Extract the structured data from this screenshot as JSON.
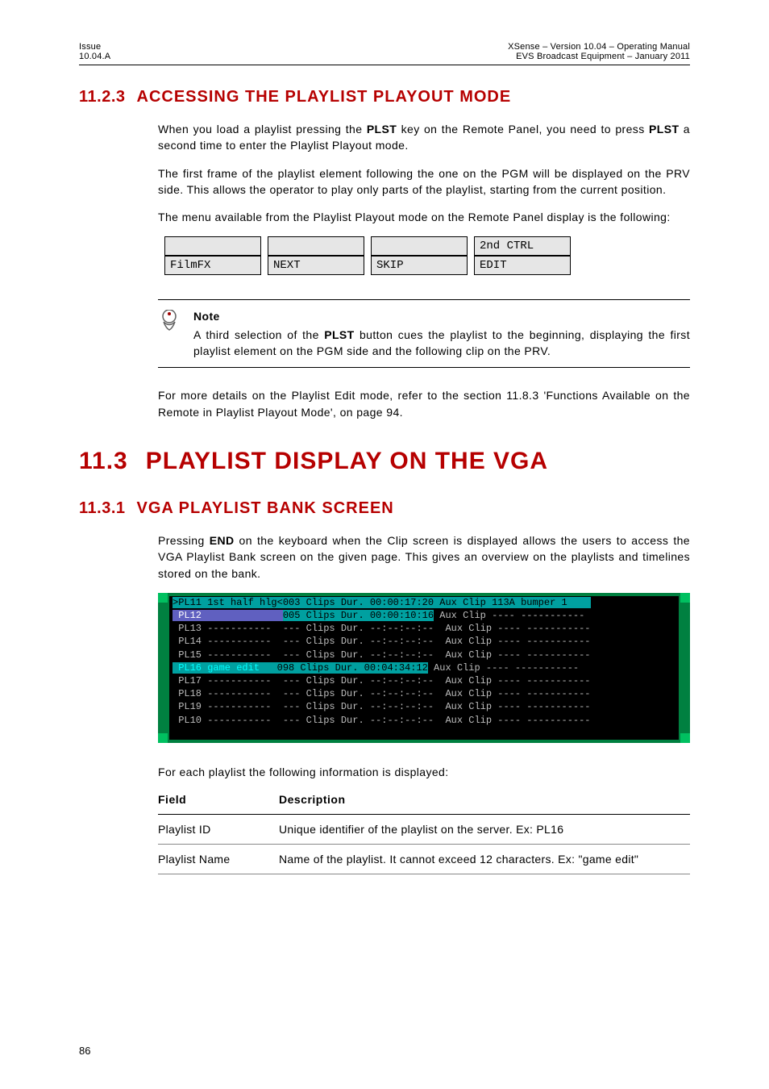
{
  "header": {
    "issue_label": "Issue",
    "issue_value": "10.04.A",
    "product": "XSense – Version 10.04 – Operating Manual",
    "vendor": "EVS Broadcast Equipment  – January 2011"
  },
  "section1": {
    "num": "11.2.3",
    "title": "ACCESSING THE PLAYLIST PLAYOUT MODE",
    "p1_a": "When you load a playlist pressing the ",
    "p1_b": "PLST",
    "p1_c": " key on the Remote Panel, you need to press ",
    "p1_d": "PLST",
    "p1_e": " a second time to enter the Playlist Playout mode.",
    "p2": "The first frame of the playlist element following the one on the PGM will be displayed on the PRV side. This allows the operator to play only parts of the playlist, starting from the current position.",
    "p3": "The menu available from the Playlist Playout mode on the Remote Panel display is the following:",
    "menu": {
      "r1c1": "",
      "r1c2": "",
      "r1c3": "",
      "r1c4": "2nd CTRL",
      "r2c1": "FilmFX",
      "r2c2": "NEXT",
      "r2c3": "SKIP",
      "r2c4": "EDIT"
    },
    "note": {
      "title": "Note",
      "body_a": "A third selection of the ",
      "body_b": "PLST",
      "body_c": " button cues the playlist to the beginning, displaying the first playlist element on the PGM side and the following clip on the PRV."
    },
    "p4": "For more details on the Playlist Edit mode, refer to the section 11.8.3 'Functions Available on the Remote in Playlist Playout Mode', on page 94."
  },
  "main": {
    "num": "11.3",
    "title": "PLAYLIST DISPLAY ON THE VGA"
  },
  "section2": {
    "num": "11.3.1",
    "title": "VGA PLAYLIST BANK SCREEN",
    "p1_a": "Pressing ",
    "p1_b": "END",
    "p1_c": " on the keyboard when the Clip screen is displayed allows the users to access the VGA Playlist Bank screen on the given page. This gives an overview on the playlists and timelines stored on the bank.",
    "vga_rows": [
      {
        "s1": ">PL11 1st half hlg<",
        "s2": "003 Clips ",
        "s3": "Dur. 00:00:17:20",
        "s4": " Aux Clip 113A bumper 1    ",
        "hl": true
      },
      {
        "s1": " PL12              ",
        "s2": "005 Clips ",
        "s3": "Dur. 00:00:10:16",
        "s4": " Aux Clip ---- ----------- ",
        "hl": true,
        "sel": true
      },
      {
        "s1": " PL13 ----------- ",
        "s2": " --- Clips ",
        "s3": "Dur. --:--:--:--",
        "s4": "  Aux Clip ---- ----------- ",
        "hl": false
      },
      {
        "s1": " PL14 ----------- ",
        "s2": " --- Clips ",
        "s3": "Dur. --:--:--:--",
        "s4": "  Aux Clip ---- ----------- ",
        "hl": false
      },
      {
        "s1": " PL15 ----------- ",
        "s2": " --- Clips ",
        "s3": "Dur. --:--:--:--",
        "s4": "  Aux Clip ---- ----------- ",
        "hl": false
      },
      {
        "s1": " PL16 game edit   ",
        "s2": "098 Clips ",
        "s3": "Dur. 00:04:34:12",
        "s4": " Aux Clip ---- ----------- ",
        "hl": true,
        "namecyan": true
      },
      {
        "s1": " PL17 ----------- ",
        "s2": " --- Clips ",
        "s3": "Dur. --:--:--:--",
        "s4": "  Aux Clip ---- ----------- ",
        "hl": false
      },
      {
        "s1": " PL18 ----------- ",
        "s2": " --- Clips ",
        "s3": "Dur. --:--:--:--",
        "s4": "  Aux Clip ---- ----------- ",
        "hl": false
      },
      {
        "s1": " PL19 ----------- ",
        "s2": " --- Clips ",
        "s3": "Dur. --:--:--:--",
        "s4": "  Aux Clip ---- ----------- ",
        "hl": false
      },
      {
        "s1": " PL10 ----------- ",
        "s2": " --- Clips ",
        "s3": "Dur. --:--:--:--",
        "s4": "  Aux Clip ---- ----------- ",
        "hl": false
      },
      {
        "s1": "                                                                         ",
        "s2": "",
        "s3": "",
        "s4": "",
        "hl": false
      }
    ],
    "p2": "For each playlist the following information is displayed:",
    "table": {
      "h1": "Field",
      "h2": "Description",
      "rows": [
        {
          "f": "Playlist ID",
          "d": "Unique identifier of the playlist on the server. Ex: PL16"
        },
        {
          "f": "Playlist Name",
          "d": "Name of the playlist. It cannot exceed 12 characters. Ex: \"game edit\""
        }
      ]
    }
  },
  "page_number": "86"
}
